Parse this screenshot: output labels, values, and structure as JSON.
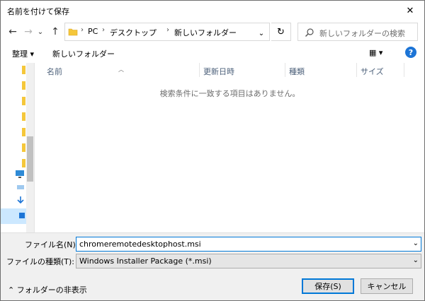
{
  "window": {
    "title": "名前を付けて保存",
    "close_glyph": "✕"
  },
  "nav": {
    "back": "←",
    "forward": "→",
    "recent": "⌄",
    "up": "↑",
    "breadcrumb": [
      "PC",
      "デスクトップ",
      "新しいフォルダー"
    ],
    "refresh": "↻",
    "search_placeholder": "新しいフォルダーの検索"
  },
  "toolbar": {
    "organize": "整理 ▾",
    "new_folder": "新しいフォルダー",
    "view": "▦ ▾",
    "help": "?"
  },
  "columns": [
    "名前",
    "更新日時",
    "種類",
    "サイズ"
  ],
  "empty_message": "検索条件に一致する項目はありません。",
  "form": {
    "filename_label": "ファイル名(N):",
    "filename_value": "chromeremotedesktophost.msi",
    "filetype_label": "ファイルの種類(T):",
    "filetype_value": "Windows Installer Package (*.msi)",
    "dropdown": "⌄"
  },
  "footer": {
    "hide_folders": "⌃ フォルダーの非表示",
    "save": "保存(S)",
    "cancel": "キャンセル"
  },
  "colors": {
    "accent": "#0078d7",
    "folder": "#f5c73b",
    "selection": "#cce8ff"
  },
  "icons": [
    "close-icon",
    "back-arrow-icon",
    "forward-arrow-icon",
    "recent-chevron-icon",
    "up-arrow-icon",
    "folder-icon",
    "chevron-right-icon",
    "refresh-icon",
    "search-icon",
    "view-options-icon",
    "help-icon",
    "pc-icon",
    "drive-icon",
    "chevron-up-icon"
  ]
}
